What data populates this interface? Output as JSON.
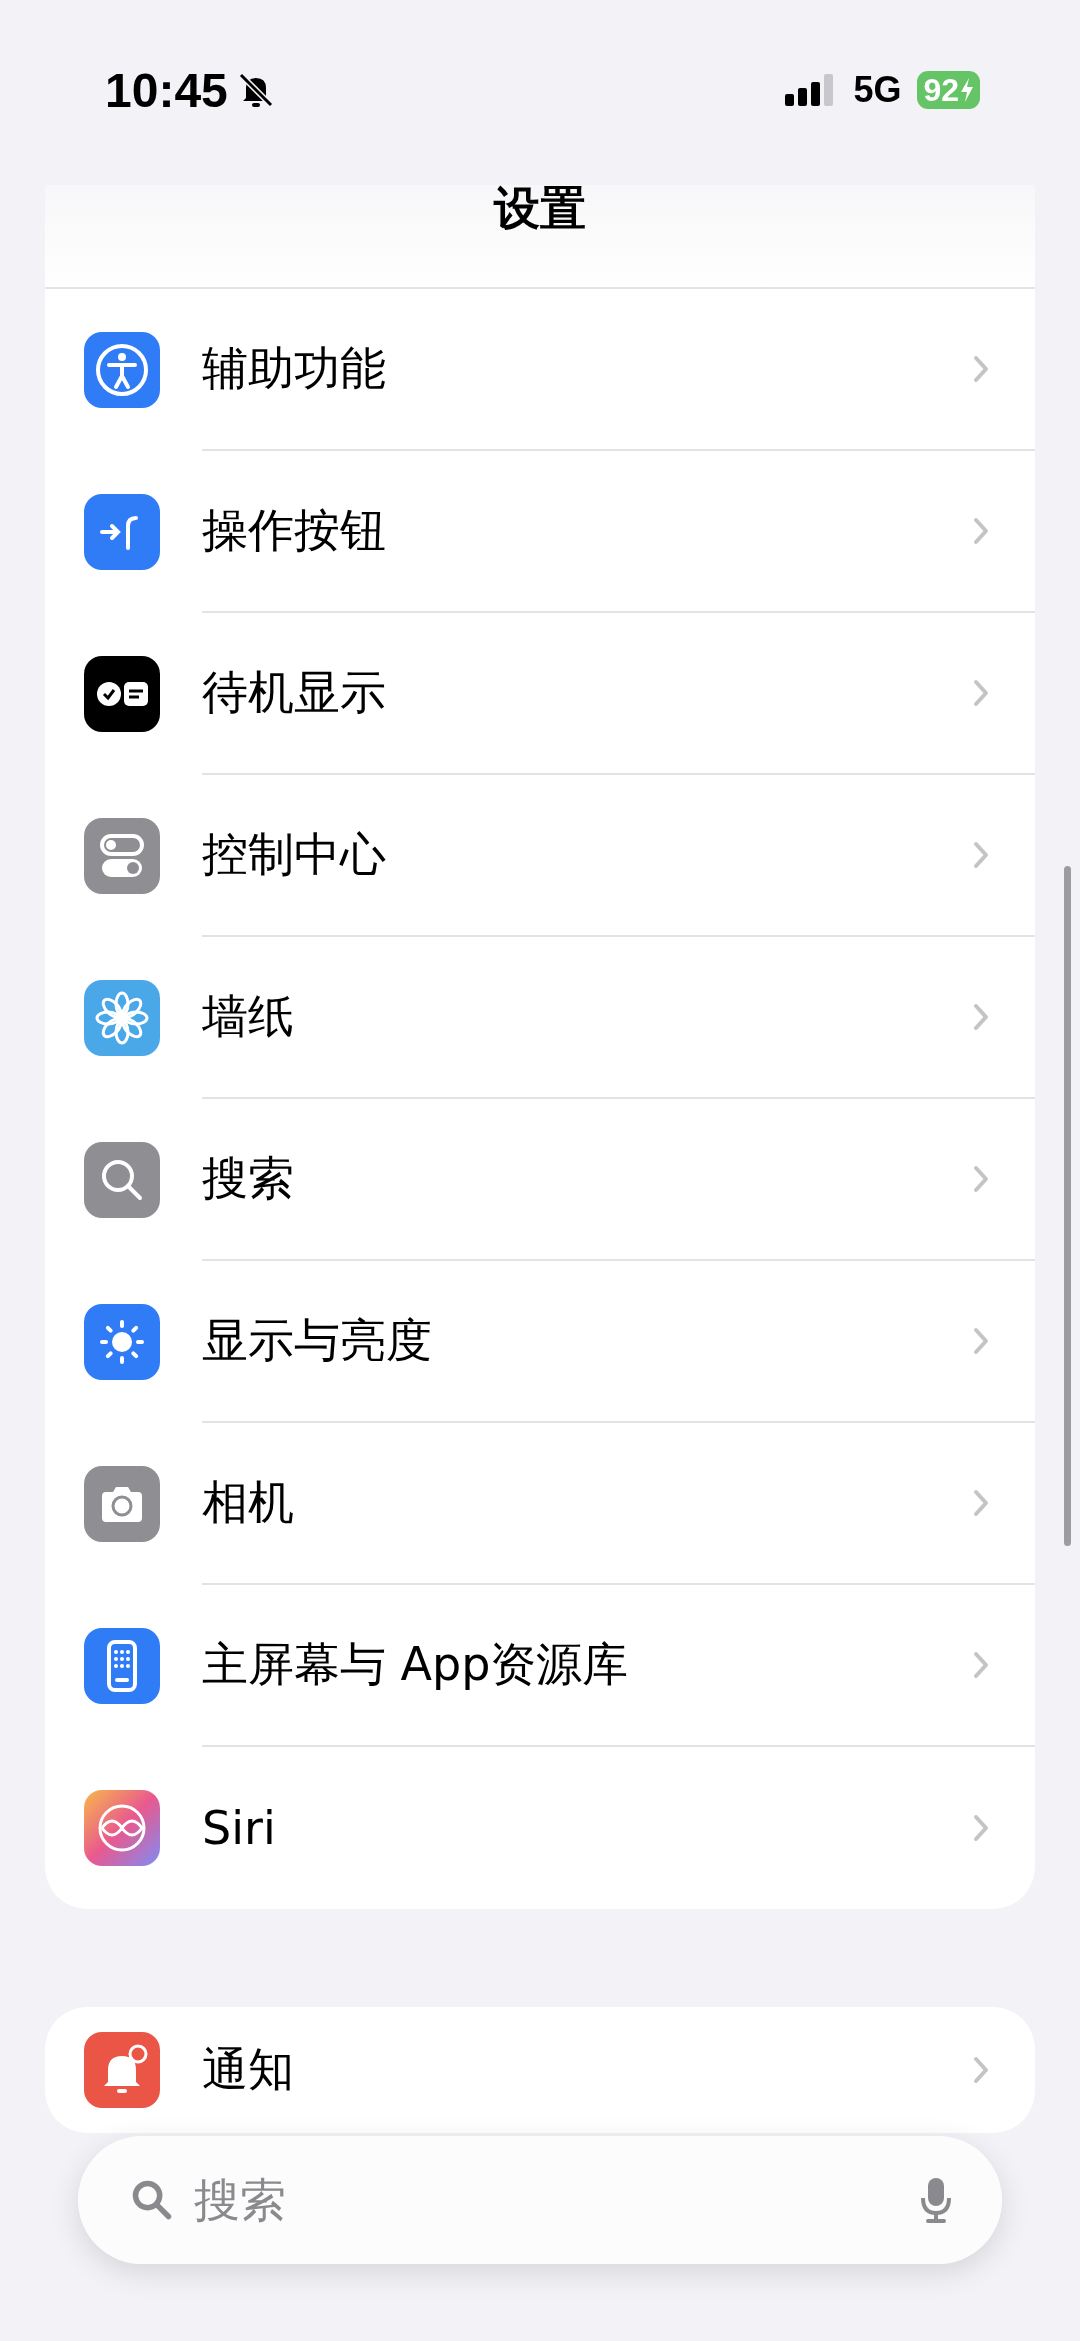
{
  "status_bar": {
    "time": "10:45",
    "silent": true,
    "network": "5G",
    "battery": "92",
    "charging": true
  },
  "title": "设置",
  "groups": [
    {
      "items": [
        {
          "kind": "accessibility",
          "label": "辅助功能"
        },
        {
          "kind": "action",
          "label": "操作按钮"
        },
        {
          "kind": "standby",
          "label": "待机显示"
        },
        {
          "kind": "control",
          "label": "控制中心"
        },
        {
          "kind": "wallpaper",
          "label": "墙纸"
        },
        {
          "kind": "search",
          "label": "搜索"
        },
        {
          "kind": "display",
          "label": "显示与亮度"
        },
        {
          "kind": "camera",
          "label": "相机"
        },
        {
          "kind": "homescreen",
          "label": "主屏幕与 App资源库"
        },
        {
          "kind": "siri",
          "label": "Siri"
        }
      ]
    },
    {
      "items": [
        {
          "kind": "notifications",
          "label": "通知"
        }
      ]
    }
  ],
  "search": {
    "placeholder": "搜索"
  }
}
